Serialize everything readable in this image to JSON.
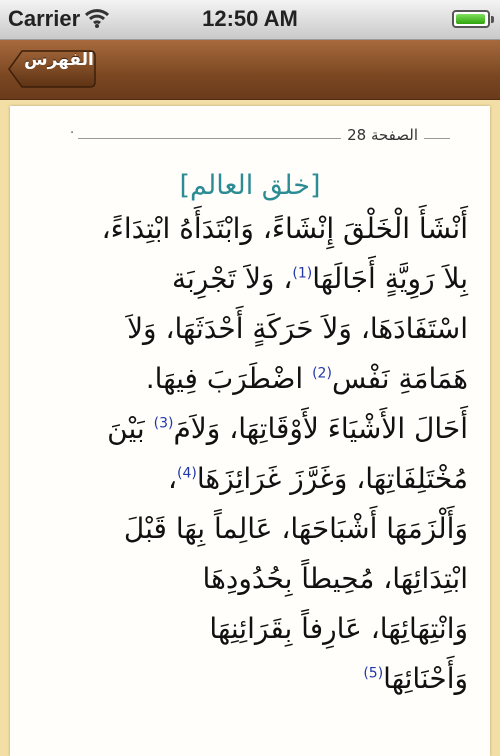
{
  "status_bar": {
    "carrier": "Carrier",
    "time": "12:50 AM",
    "battery_level": 0.95
  },
  "nav": {
    "back_label": "الفهرس"
  },
  "page": {
    "header_label": "الصفحة 28",
    "header_dot": "·",
    "chapter_title": "[خلق العالم]",
    "lines": [
      {
        "parts": [
          {
            "text": "أَنْشَأَ الْخَلْقَ إِنْشَاءً، وَابْتَدَأَهُ ابْتِدَاءً،"
          }
        ]
      },
      {
        "parts": [
          {
            "text": "بِلاَ رَوِيَّةٍ أَجَالَهَا"
          },
          {
            "fn": "(1)"
          },
          {
            "text": "، وَلاَ تَجْرِبَة"
          }
        ]
      },
      {
        "parts": [
          {
            "text": "اسْتَفَادَهَا، وَلاَ حَرَكَةٍ أَحْدَثَهَا، وَلاَ"
          }
        ]
      },
      {
        "parts": [
          {
            "text": "هَمَامَةِ نَفْس"
          },
          {
            "fn": "(2)"
          },
          {
            "text": " اضْطَرَبَ فِيهَا."
          }
        ]
      },
      {
        "parts": [
          {
            "text": "أَحَالَ الأَشْيَاءَ لأَوْقَاتِهَا، وَلاَمَ"
          },
          {
            "fn": "(3)"
          },
          {
            "text": " بَيْنَ"
          }
        ]
      },
      {
        "parts": [
          {
            "text": "مُخْتَلِفَاتِهَا، وَغَرَّزَ غَرَائِزَهَا"
          },
          {
            "fn": "(4)"
          },
          {
            "text": "،"
          }
        ]
      },
      {
        "parts": [
          {
            "text": "وَأَلْزَمَهَا أَشْبَاحَهَا، عَالِماً بِهَا قَبْلَ"
          }
        ]
      },
      {
        "parts": [
          {
            "text": "ابْتِدَائِهَا، مُحِيطاً بِحُدُودِهَا"
          }
        ]
      },
      {
        "parts": [
          {
            "text": "وَانْتِهَائِهَا، عَارِفاً بِقَرَائِنِهَا"
          }
        ]
      },
      {
        "parts": [
          {
            "text": "وَأَحْنَائِهَا"
          },
          {
            "fn": "(5)"
          }
        ]
      }
    ]
  },
  "colors": {
    "nav_brown": "#7b4722",
    "background": "#f3dfa6",
    "title": "#2b8c94",
    "footnote": "#2238a8"
  }
}
